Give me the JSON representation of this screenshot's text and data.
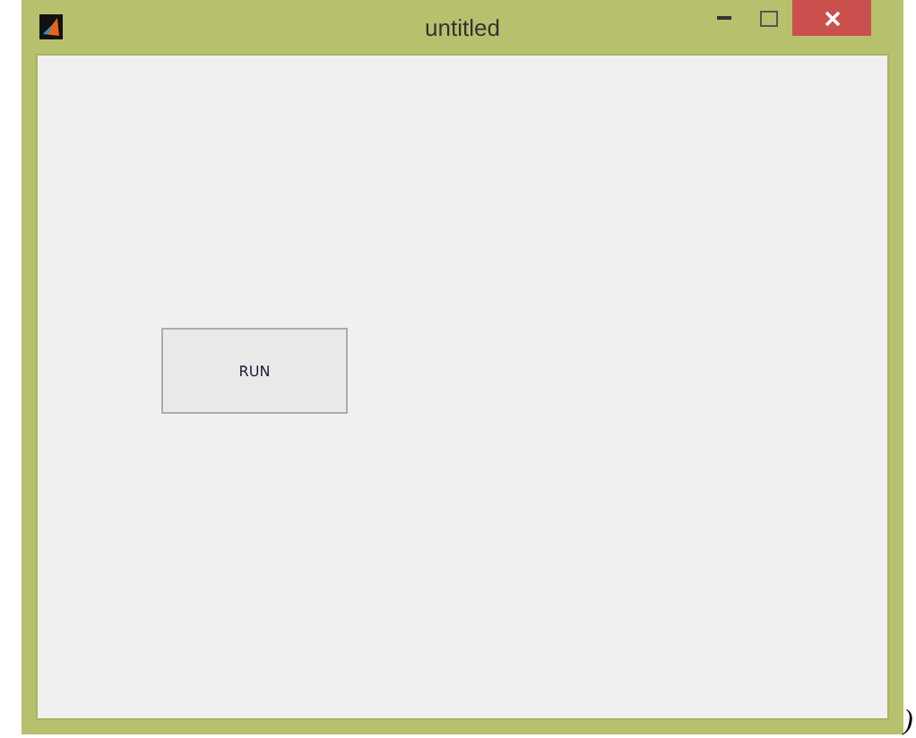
{
  "window": {
    "title": "untitled"
  },
  "controls": [
    {
      "kind": "button",
      "label": "RUN"
    }
  ],
  "backdrop_text": ")"
}
